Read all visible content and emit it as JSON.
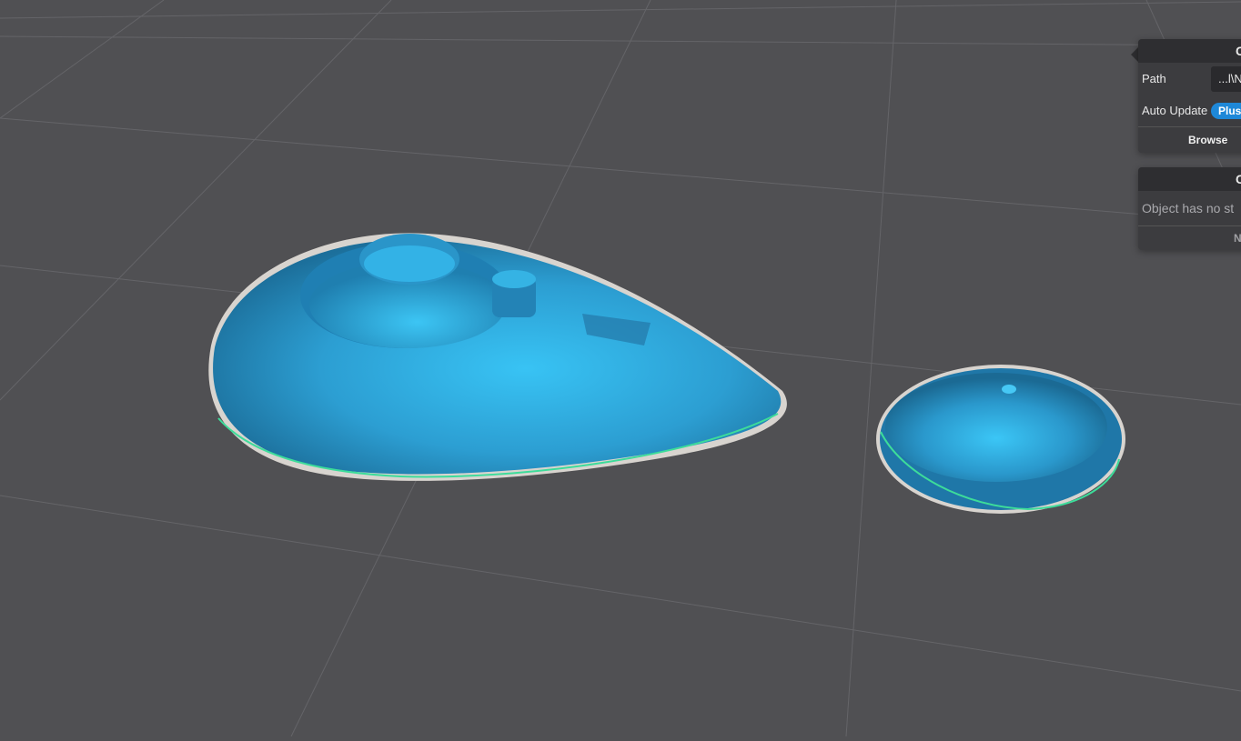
{
  "object_panel": {
    "title": "C",
    "path_label": "Path",
    "path_value": "...l\\N",
    "auto_update_label": "Auto Update",
    "auto_update_value": "Plus",
    "browse_label": "Browse"
  },
  "info_panel": {
    "title": "C",
    "message": "Object has no st",
    "footer_label": "N"
  },
  "colors": {
    "background": "#505053",
    "model": "#2f9fd6",
    "toggle": "#1e88d8"
  }
}
